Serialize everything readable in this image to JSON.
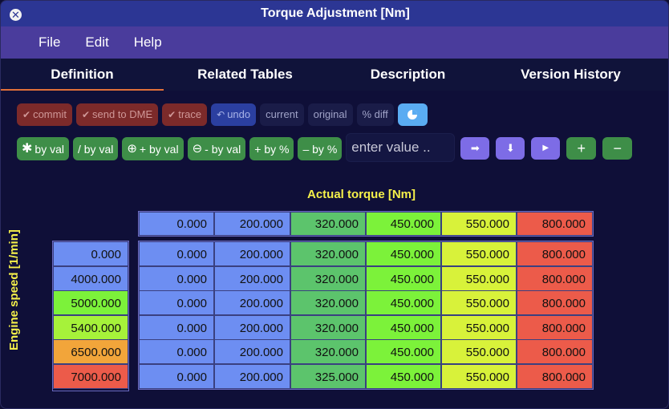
{
  "window": {
    "title": "Torque Adjustment [Nm]"
  },
  "menu": [
    "File",
    "Edit",
    "Help"
  ],
  "tabs": [
    "Definition",
    "Related Tables",
    "Description",
    "Version History"
  ],
  "toolbar1": {
    "commit": "commit",
    "send": "send to DME",
    "trace": "trace",
    "undo": "undo",
    "current": "current",
    "original": "original",
    "pct_diff": "% diff"
  },
  "toolbar2": {
    "mul_val": "by val",
    "div_val": "/ by val",
    "add_val": "+ by val",
    "sub_val": "- by val",
    "add_pct": "+ by %",
    "sub_pct": "– by %",
    "input_placeholder": "enter value .."
  },
  "table": {
    "x_label": "Actual torque [Nm]",
    "y_label": "Engine speed [1/min]",
    "columns": [
      "0.000",
      "200.000",
      "320.000",
      "450.000",
      "550.000",
      "800.000"
    ],
    "rows": [
      "0.000",
      "4000.000",
      "5000.000",
      "5400.000",
      "6500.000",
      "7000.000"
    ],
    "values": [
      [
        "0.000",
        "200.000",
        "320.000",
        "450.000",
        "550.000",
        "800.000"
      ],
      [
        "0.000",
        "200.000",
        "320.000",
        "450.000",
        "550.000",
        "800.000"
      ],
      [
        "0.000",
        "200.000",
        "320.000",
        "450.000",
        "550.000",
        "800.000"
      ],
      [
        "0.000",
        "200.000",
        "320.000",
        "450.000",
        "550.000",
        "800.000"
      ],
      [
        "0.000",
        "200.000",
        "320.000",
        "450.000",
        "550.000",
        "800.000"
      ],
      [
        "0.000",
        "200.000",
        "325.000",
        "450.000",
        "550.000",
        "800.000"
      ]
    ],
    "column_colors": [
      "#6d8ef2",
      "#6d8ef2",
      "#5cc46c",
      "#7cf23a",
      "#d8f23a",
      "#ec5b4a"
    ],
    "row_colors": [
      "#6d8ef2",
      "#6d8ef2",
      "#7cf23a",
      "#a6f23a",
      "#f2a53a",
      "#ec5b4a"
    ]
  }
}
